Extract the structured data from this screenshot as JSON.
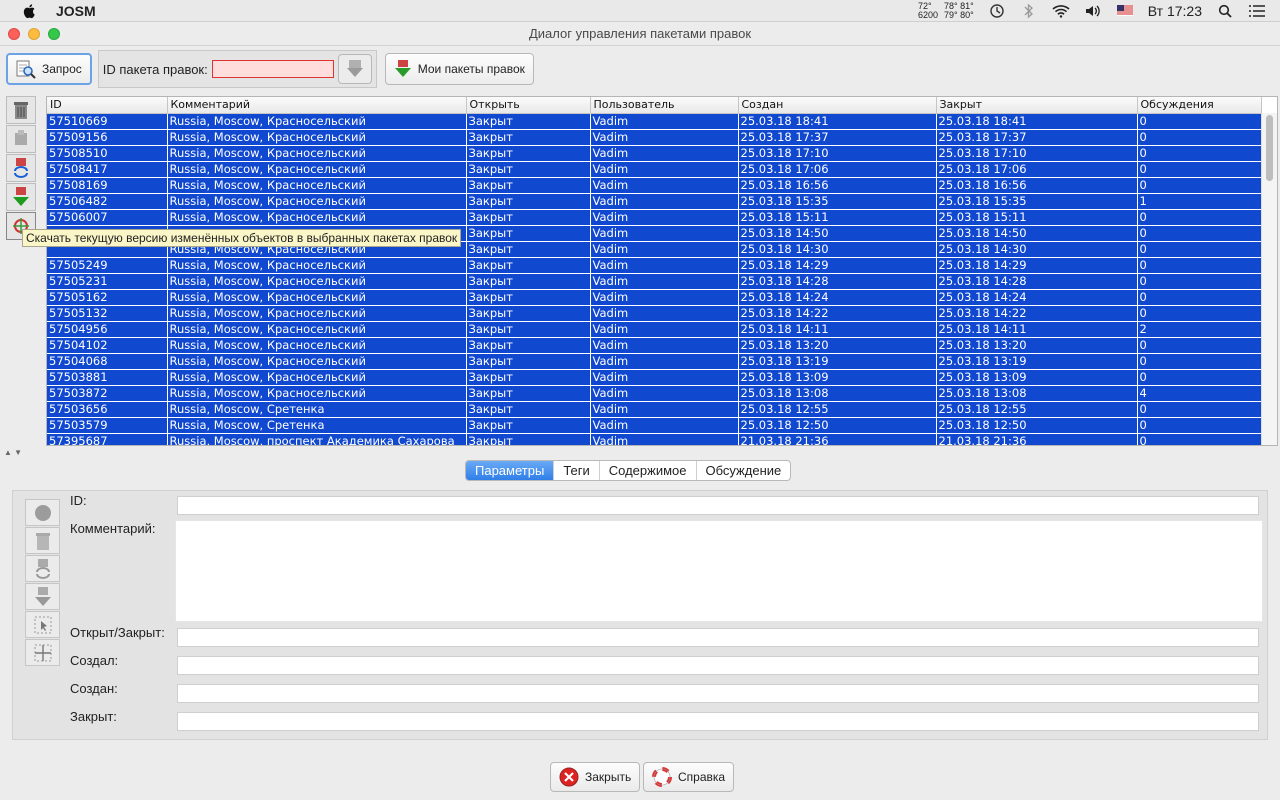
{
  "menubar": {
    "app_name": "JOSM",
    "temps_col1": [
      "72°",
      "6200"
    ],
    "temps_col2": [
      "78° 81°",
      "79° 80°"
    ],
    "clock": "Вт 17:23"
  },
  "window": {
    "title": "Диалог управления пакетами правок"
  },
  "toolbar": {
    "query_label": "Запрос",
    "id_label": "ID пакета правок:",
    "id_value": "",
    "my_changesets_label": "Мои пакеты правок"
  },
  "tooltip": "Скачать текущую версию изменённых объектов в выбранных пакетах правок",
  "table": {
    "columns": [
      "ID",
      "Комментарий",
      "Открыть",
      "Пользователь",
      "Создан",
      "Закрыт",
      "Обсуждения"
    ],
    "rows": [
      [
        "57510669",
        "Russia, Moscow, Красносельский",
        "Закрыт",
        "Vadim",
        "25.03.18 18:41",
        "25.03.18 18:41",
        "0"
      ],
      [
        "57509156",
        "Russia, Moscow, Красносельский",
        "Закрыт",
        "Vadim",
        "25.03.18 17:37",
        "25.03.18 17:37",
        "0"
      ],
      [
        "57508510",
        "Russia, Moscow, Красносельский",
        "Закрыт",
        "Vadim",
        "25.03.18 17:10",
        "25.03.18 17:10",
        "0"
      ],
      [
        "57508417",
        "Russia, Moscow, Красносельский",
        "Закрыт",
        "Vadim",
        "25.03.18 17:06",
        "25.03.18 17:06",
        "0"
      ],
      [
        "57508169",
        "Russia, Moscow, Красносельский",
        "Закрыт",
        "Vadim",
        "25.03.18 16:56",
        "25.03.18 16:56",
        "0"
      ],
      [
        "57506482",
        "Russia, Moscow, Красносельский",
        "Закрыт",
        "Vadim",
        "25.03.18 15:35",
        "25.03.18 15:35",
        "1"
      ],
      [
        "57506007",
        "Russia, Moscow, Красносельский",
        "Закрыт",
        "Vadim",
        "25.03.18 15:11",
        "25.03.18 15:11",
        "0"
      ],
      [
        "",
        "",
        "Закрыт",
        "Vadim",
        "25.03.18 14:50",
        "25.03.18 14:50",
        "0"
      ],
      [
        "",
        "Russia, Moscow, Красносельский",
        "Закрыт",
        "Vadim",
        "25.03.18 14:30",
        "25.03.18 14:30",
        "0"
      ],
      [
        "57505249",
        "Russia, Moscow, Красносельский",
        "Закрыт",
        "Vadim",
        "25.03.18 14:29",
        "25.03.18 14:29",
        "0"
      ],
      [
        "57505231",
        "Russia, Moscow, Красносельский",
        "Закрыт",
        "Vadim",
        "25.03.18 14:28",
        "25.03.18 14:28",
        "0"
      ],
      [
        "57505162",
        "Russia, Moscow, Красносельский",
        "Закрыт",
        "Vadim",
        "25.03.18 14:24",
        "25.03.18 14:24",
        "0"
      ],
      [
        "57505132",
        "Russia, Moscow, Красносельский",
        "Закрыт",
        "Vadim",
        "25.03.18 14:22",
        "25.03.18 14:22",
        "0"
      ],
      [
        "57504956",
        "Russia, Moscow, Красносельский",
        "Закрыт",
        "Vadim",
        "25.03.18 14:11",
        "25.03.18 14:11",
        "2"
      ],
      [
        "57504102",
        "Russia, Moscow, Красносельский",
        "Закрыт",
        "Vadim",
        "25.03.18 13:20",
        "25.03.18 13:20",
        "0"
      ],
      [
        "57504068",
        "Russia, Moscow, Красносельский",
        "Закрыт",
        "Vadim",
        "25.03.18 13:19",
        "25.03.18 13:19",
        "0"
      ],
      [
        "57503881",
        "Russia, Moscow, Красносельский",
        "Закрыт",
        "Vadim",
        "25.03.18 13:09",
        "25.03.18 13:09",
        "0"
      ],
      [
        "57503872",
        "Russia, Moscow, Красносельский",
        "Закрыт",
        "Vadim",
        "25.03.18 13:08",
        "25.03.18 13:08",
        "4"
      ],
      [
        "57503656",
        "Russia, Moscow, Сретенка",
        "Закрыт",
        "Vadim",
        "25.03.18 12:55",
        "25.03.18 12:55",
        "0"
      ],
      [
        "57503579",
        "Russia, Moscow, Сретенка",
        "Закрыт",
        "Vadim",
        "25.03.18 12:50",
        "25.03.18 12:50",
        "0"
      ],
      [
        "57395687",
        "Russia, Moscow, проспект Академика Сахарова",
        "Закрыт",
        "Vadim",
        "21.03.18 21:36",
        "21.03.18 21:36",
        "0"
      ]
    ]
  },
  "tabs": [
    "Параметры",
    "Теги",
    "Содержимое",
    "Обсуждение"
  ],
  "details": {
    "id_label": "ID:",
    "comment_label": "Комментарий:",
    "open_closed_label": "Открыт/Закрыт:",
    "created_by_label": "Создал:",
    "created_label": "Создан:",
    "closed_label": "Закрыт:"
  },
  "buttons": {
    "close": "Закрыть",
    "help": "Справка"
  },
  "colors": {
    "selection": "#1048d0",
    "tab_active": "#2f7ee8"
  }
}
